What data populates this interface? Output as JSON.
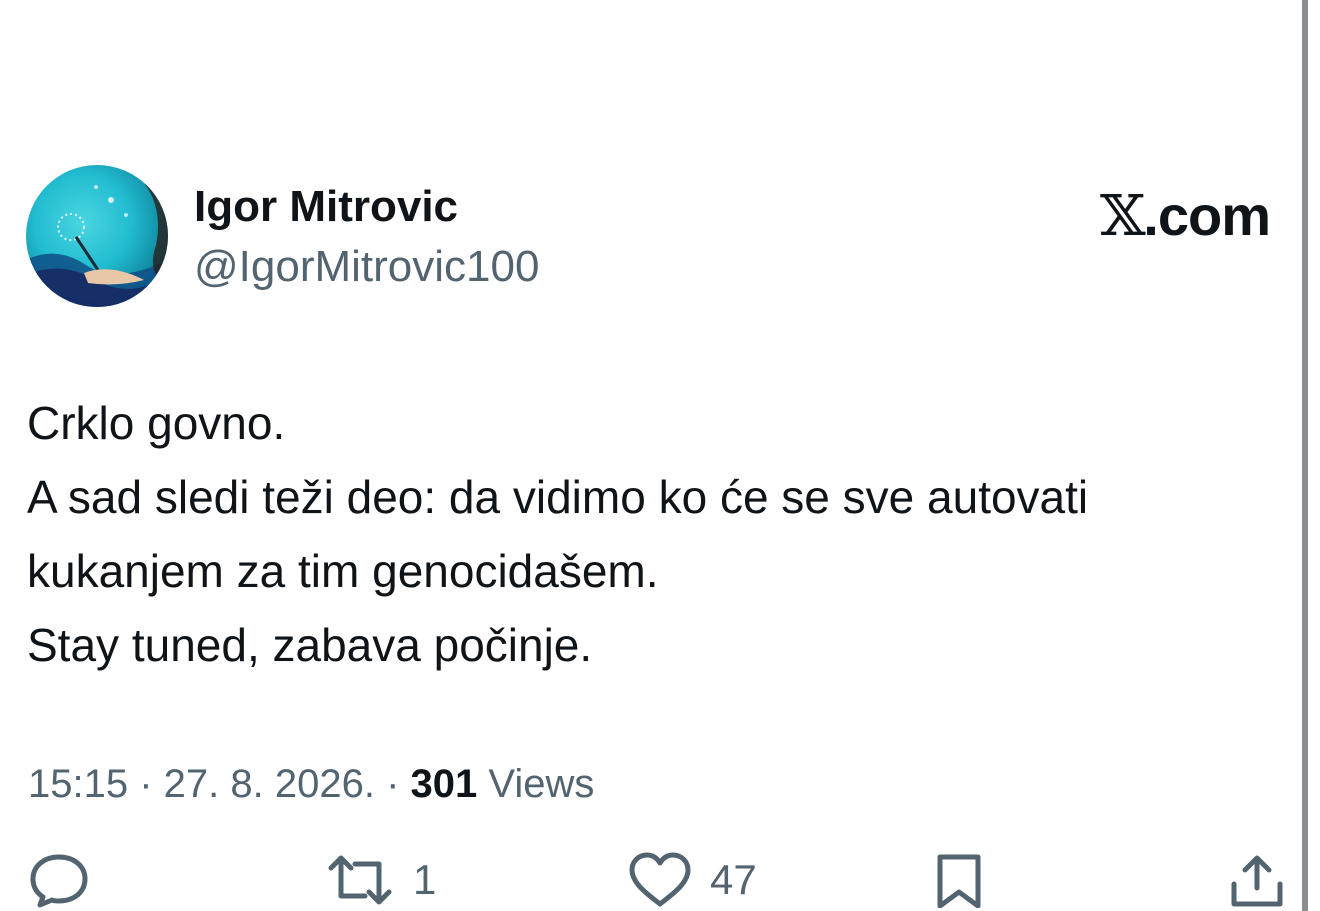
{
  "tweet": {
    "author": {
      "display_name": "Igor Mitrovic",
      "handle": "@IgorMitrovic100"
    },
    "brand": {
      "x_glyph": "𝕏",
      "suffix": ".com"
    },
    "text_lines": [
      "Crklo govno.",
      "A sad sledi teži deo: da vidimo ko će se sve autovati",
      "kukanjem za tim genocidašem.",
      "Stay tuned, zabava počinje."
    ],
    "meta": {
      "time": "15:15",
      "date": "27. 8. 2026.",
      "separator": " · ",
      "views_count": "301",
      "views_label": "Views"
    },
    "actions": {
      "reply": {
        "icon": "reply-icon",
        "count": ""
      },
      "repost": {
        "icon": "repost-icon",
        "count": "1"
      },
      "like": {
        "icon": "heart-icon",
        "count": "47"
      },
      "bookmark": {
        "icon": "bookmark-icon",
        "count": ""
      },
      "share": {
        "icon": "share-icon",
        "count": ""
      }
    }
  },
  "colors": {
    "text_primary": "#0f1419",
    "text_secondary": "#536471",
    "background": "#ffffff"
  }
}
